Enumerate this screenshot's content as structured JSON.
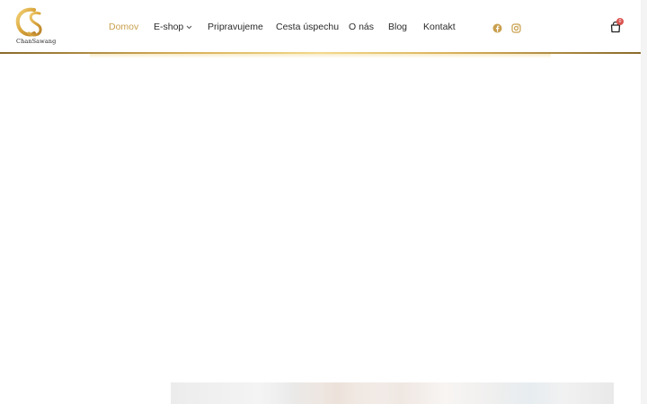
{
  "brand": {
    "logo_text": "ChanSawang",
    "accent_color": "#c9a04e"
  },
  "nav": {
    "items": [
      {
        "label": "Domov",
        "active": true
      },
      {
        "label": "E-shop",
        "active": false,
        "has_dropdown": true
      },
      {
        "label": "Pripravujeme",
        "active": false
      },
      {
        "label": "Cesta úspechu",
        "active": false
      },
      {
        "label": "O nás",
        "active": false
      },
      {
        "label": "Blog",
        "active": false
      },
      {
        "label": "Kontakt",
        "active": false
      }
    ]
  },
  "social": {
    "icons": [
      "facebook-icon",
      "instagram-icon"
    ]
  },
  "cart": {
    "icon": "shopping-bag-icon",
    "count": "0",
    "badge_color": "#d9534f"
  }
}
